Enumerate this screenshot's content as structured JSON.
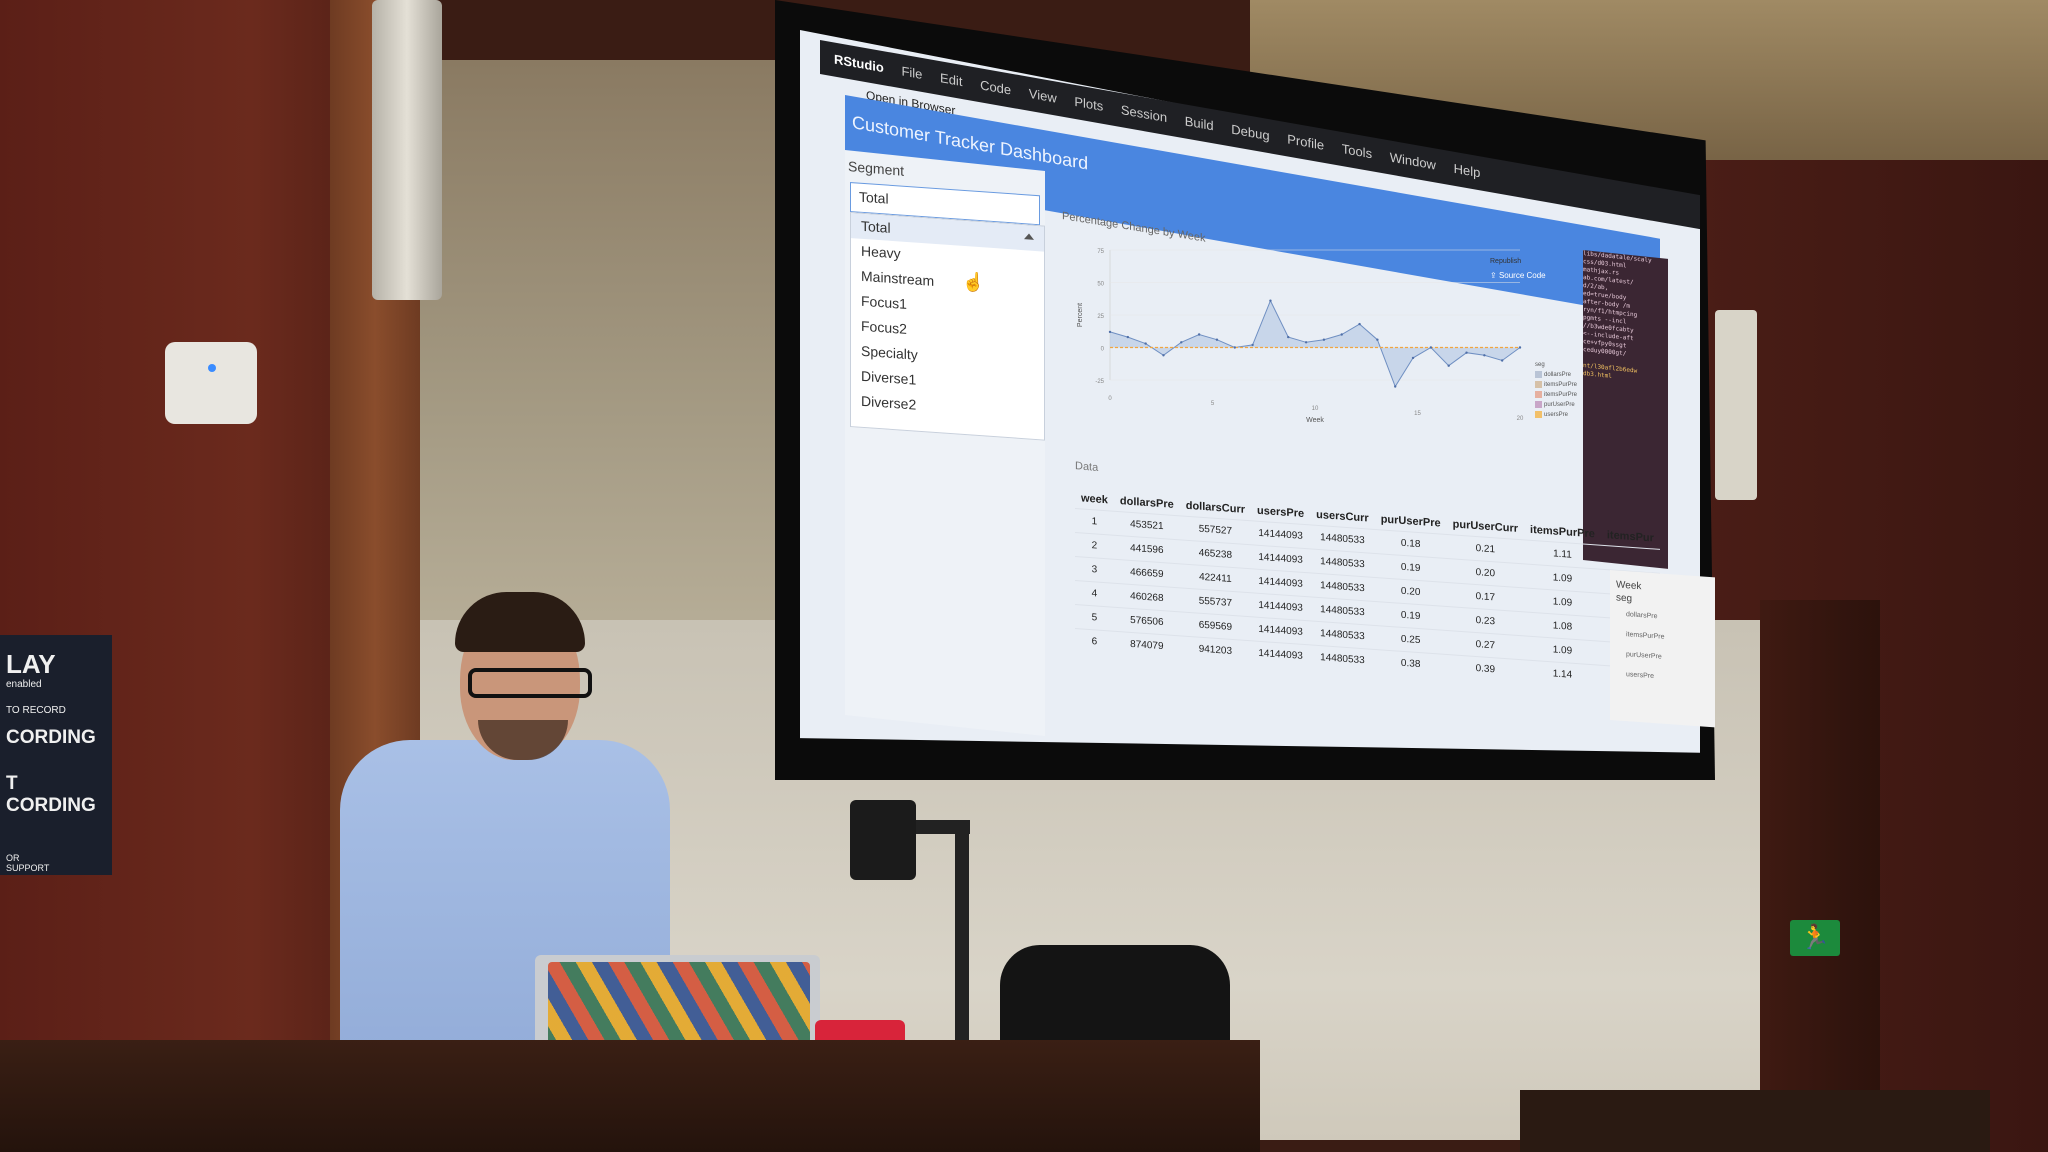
{
  "menubar": {
    "items": [
      "RStudio",
      "File",
      "Edit",
      "Code",
      "View",
      "Plots",
      "Session",
      "Build",
      "Debug",
      "Profile",
      "Tools",
      "Window",
      "Help"
    ]
  },
  "app": {
    "open_in_browser": "Open in Browser",
    "title": "Customer Tracker Dashboard"
  },
  "sidebar": {
    "segment_label": "Segment",
    "segment_value": "Total",
    "dropdown_options": [
      "Total",
      "Heavy",
      "Mainstream",
      "Focus1",
      "Focus2",
      "Specialty",
      "Diverse1",
      "Diverse2"
    ]
  },
  "plot": {
    "title": "Percentage Change by Week",
    "toolbar": {
      "republish": "Republish",
      "source_code": "Source Code"
    },
    "legend_title": "seg",
    "legend_entries": [
      "dollarsPre",
      "itemsPurPre",
      "itemsPurPre",
      "purUserPre",
      "usersPre"
    ],
    "legend_colors": [
      "#b9c4d6",
      "#d6c1a8",
      "#e6b0a0",
      "#c8a6c8",
      "#f2c06a"
    ]
  },
  "chart_data": {
    "type": "area",
    "title": "Percentage Change by Week",
    "xlabel": "Week",
    "ylabel": "Percent",
    "yticks": [
      "75",
      "50",
      "25",
      "0",
      "-25"
    ],
    "xticks": [
      "0",
      "5",
      "10",
      "15",
      "20"
    ],
    "series": [
      {
        "name": "dollarsPre",
        "values": [
          12,
          8,
          3,
          -6,
          4,
          10,
          6,
          0,
          2,
          36,
          8,
          4,
          6,
          10,
          18,
          6,
          -30,
          -8,
          0,
          -14,
          -4,
          -6,
          -10,
          0
        ]
      }
    ]
  },
  "data_section": {
    "label": "Data",
    "columns": [
      "week",
      "dollarsPre",
      "dollarsCurr",
      "usersPre",
      "usersCurr",
      "purUserPre",
      "purUserCurr",
      "itemsPurPre",
      "itemsPur"
    ],
    "rows": [
      [
        "1",
        "453521",
        "557527",
        "14144093",
        "14480533",
        "0.18",
        "0.21",
        "1.11",
        ""
      ],
      [
        "2",
        "441596",
        "465238",
        "14144093",
        "14480533",
        "0.19",
        "0.20",
        "1.09",
        ""
      ],
      [
        "3",
        "466659",
        "422411",
        "14144093",
        "14480533",
        "0.20",
        "0.17",
        "1.09",
        ""
      ],
      [
        "4",
        "460268",
        "555737",
        "14144093",
        "14480533",
        "0.19",
        "0.23",
        "1.08",
        ""
      ],
      [
        "5",
        "576506",
        "659569",
        "14144093",
        "14480533",
        "0.25",
        "0.27",
        "1.09",
        ""
      ],
      [
        "6",
        "874079",
        "941203",
        "14144093",
        "14480533",
        "0.38",
        "0.39",
        "1.14",
        ""
      ]
    ]
  },
  "code_panel": {
    "lines": [
      "libs/dadatale/scaly",
      "css/d03.html",
      "mathjax.rs",
      "ab.com/latest/",
      "d/2/ab,",
      "ed=true/body",
      "after-body /m",
      "ryn/f1/htmpcing",
      "pgmts --incl",
      "//b3wde0fcabty",
      "<--include-aft",
      "ce+vfpy0ssgt",
      "ceduy0000gt/",
      "",
      "nt/l30afl2b6edw",
      "db3.html"
    ]
  },
  "second_screen": {
    "axis_label": "Week",
    "legend_title": "seg",
    "legend_entries": [
      "dollarsPre",
      "itemsPurPre",
      "purUserPre",
      "usersPre"
    ]
  },
  "room_sign": {
    "lines": [
      "LAY",
      "enabled",
      "TO RECORD",
      "CORDING",
      "T",
      "CORDING",
      "OR",
      "SUPPORT"
    ]
  }
}
